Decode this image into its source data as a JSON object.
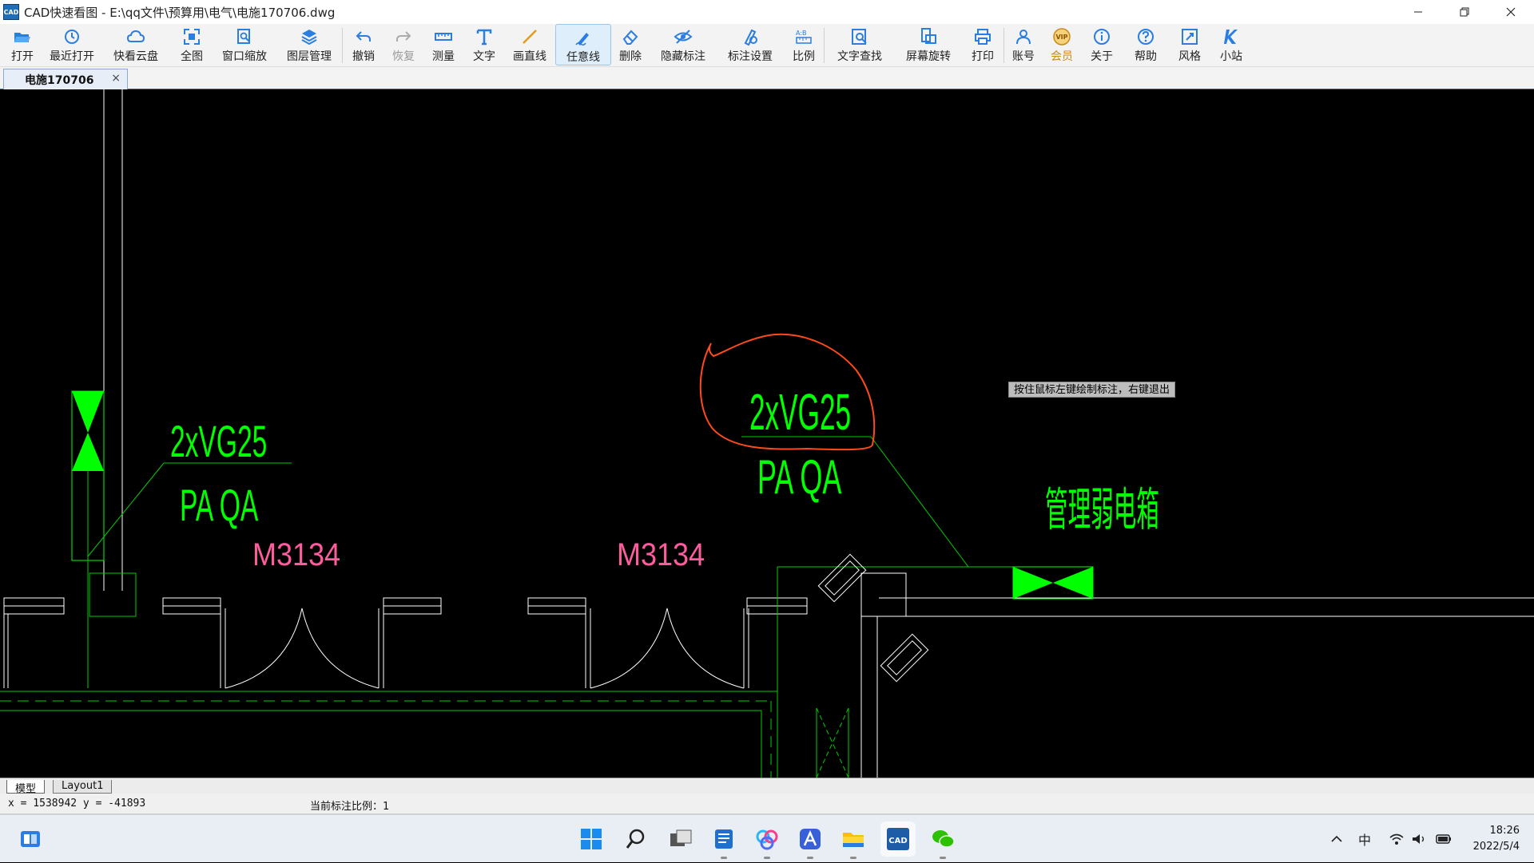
{
  "window": {
    "title": "CAD快速看图 - E:\\qq文件\\预算用\\电气\\电施170706.dwg",
    "app_icon_text": "CAD",
    "controls": [
      "minimize-icon",
      "restore-icon",
      "close-icon"
    ]
  },
  "toolbar": {
    "items": [
      {
        "label": "打开",
        "icon": "folder-open-icon"
      },
      {
        "label": "最近打开",
        "icon": "history-icon"
      },
      {
        "label": "快看云盘",
        "icon": "cloud-icon"
      },
      {
        "label": "全图",
        "icon": "fit-all-icon"
      },
      {
        "label": "窗口缩放",
        "icon": "window-zoom-icon"
      },
      {
        "label": "图层管理",
        "icon": "layers-icon"
      },
      {
        "label": "撤销",
        "icon": "undo-icon"
      },
      {
        "label": "恢复",
        "icon": "redo-icon",
        "disabled": true
      },
      {
        "label": "测量",
        "icon": "ruler-icon"
      },
      {
        "label": "文字",
        "icon": "text-icon"
      },
      {
        "label": "画直线",
        "icon": "line-icon"
      },
      {
        "label": "任意线",
        "icon": "freehand-pen-icon",
        "active": true
      },
      {
        "label": "删除",
        "icon": "eraser-icon"
      },
      {
        "label": "隐藏标注",
        "icon": "eye-hide-icon"
      },
      {
        "label": "标注设置",
        "icon": "annotation-settings-icon"
      },
      {
        "label": "比例",
        "icon": "scale-icon"
      },
      {
        "label": "文字查找",
        "icon": "text-search-icon"
      },
      {
        "label": "屏幕旋转",
        "icon": "rotate-screen-icon"
      },
      {
        "label": "打印",
        "icon": "printer-icon"
      },
      {
        "label": "账号",
        "icon": "user-icon"
      },
      {
        "label": "会员",
        "icon": "vip-icon",
        "vip": true
      },
      {
        "label": "关于",
        "icon": "info-icon"
      },
      {
        "label": "帮助",
        "icon": "help-icon"
      },
      {
        "label": "风格",
        "icon": "style-icon"
      },
      {
        "label": "小站",
        "icon": "site-icon"
      }
    ],
    "vip_badge": "VIP"
  },
  "doc_tab": {
    "label": "电施170706",
    "close": "×"
  },
  "drawing": {
    "labels": {
      "cable_left": "2xVG25",
      "phase_left": "PA QA",
      "door_left": "M3134",
      "door_right": "M3134",
      "cable_right": "2xVG25",
      "phase_right": "PA QA",
      "box": "管理弱电箱"
    },
    "colors": {
      "green": "#00ff00",
      "green_line": "#00cc00",
      "magenta": "#ff5c9e",
      "white": "#ffffff",
      "orange": "#ff4a1c"
    }
  },
  "hint": "按住鼠标左键绘制标注，右键退出",
  "layout_tabs": [
    "模型",
    "Layout1"
  ],
  "status": {
    "coords": "x = 1538942  y = -41893",
    "scale": "当前标注比例：1"
  },
  "taskbar": {
    "apps": [
      "start-icon",
      "search-icon",
      "task-view-icon",
      "notepad-icon",
      "baidu-netdisk-icon",
      "typora-icon",
      "file-explorer-icon",
      "cad-viewer-icon",
      "wechat-icon"
    ],
    "tray": {
      "ime": "中",
      "icons": [
        "chevron-up-icon",
        "wifi-icon",
        "speaker-icon",
        "battery-icon"
      ]
    },
    "time": "18:26",
    "date": "2022/5/4"
  }
}
